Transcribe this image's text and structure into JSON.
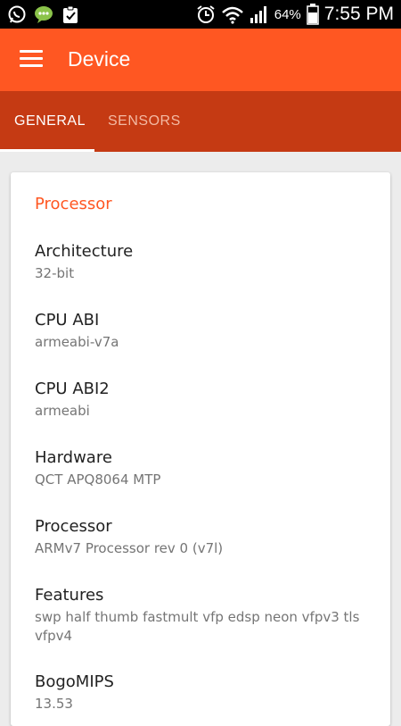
{
  "status_bar": {
    "battery": "64%",
    "time": "7:55 PM",
    "icons_left": [
      "whatsapp-icon",
      "messenger-icon",
      "clipboard-icon"
    ],
    "icons_right": [
      "alarm-icon",
      "wifi-icon",
      "signal-icon",
      "battery-icon"
    ]
  },
  "app_bar": {
    "title": "Device",
    "menu_icon": "hamburger-menu-icon",
    "color": "#ff5722"
  },
  "tabs": [
    {
      "label": "GENERAL",
      "selected": true
    },
    {
      "label": "SENSORS",
      "selected": false
    }
  ],
  "card": {
    "section_title": "Processor",
    "items": [
      {
        "label": "Architecture",
        "value": "32-bit"
      },
      {
        "label": "CPU ABI",
        "value": "armeabi-v7a"
      },
      {
        "label": "CPU ABI2",
        "value": "armeabi"
      },
      {
        "label": "Hardware",
        "value": "QCT APQ8064 MTP"
      },
      {
        "label": "Processor",
        "value": "ARMv7 Processor rev 0 (v7l)"
      },
      {
        "label": "Features",
        "value": "swp half thumb fastmult vfp edsp neon vfpv3 tls vfpv4"
      },
      {
        "label": "BogoMIPS",
        "value": "13.53"
      }
    ]
  }
}
